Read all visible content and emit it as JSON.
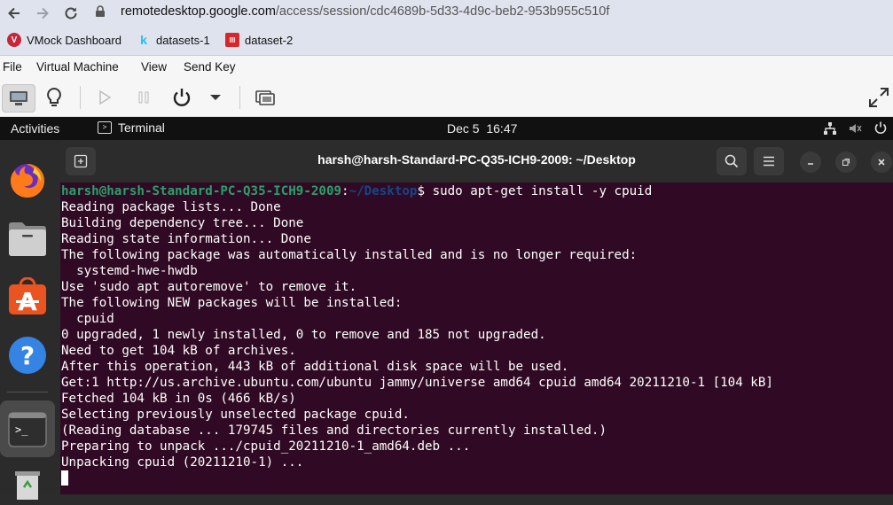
{
  "browser": {
    "url_host": "remotedesktop.google.com",
    "url_path": "/access/session/cdc4689b-5d33-4d9c-beb2-953b955c510f",
    "icons": [
      "back-arrow-icon",
      "forward-arrow-icon",
      "reload-icon",
      "site-info-icon"
    ]
  },
  "bookmarks": [
    {
      "label": "VMock Dashboard",
      "icon": "vmock-icon"
    },
    {
      "label": "datasets-1",
      "icon": "kaggle-icon"
    },
    {
      "label": "dataset-2",
      "icon": "iiith-icon"
    }
  ],
  "vm_menu": [
    "File",
    "Virtual Machine",
    "View",
    "Send Key"
  ],
  "vm_toolbar": {
    "icons": [
      "display-console-icon",
      "bulb-icon",
      "play-icon",
      "pause-icon",
      "power-icon",
      "dropdown-arrow-icon",
      "screenshot-icon",
      "fullscreen-icon"
    ]
  },
  "gnome": {
    "activities": "Activities",
    "app_name": "Terminal",
    "clock": "Dec 5  16:47",
    "status_icons": [
      "network-icon",
      "volume-muted-icon",
      "power-icon"
    ]
  },
  "dock": [
    "firefox-icon",
    "files-icon",
    "app-store-icon",
    "help-icon",
    "terminal-icon",
    "trash-icon"
  ],
  "terminal": {
    "title": "harsh@harsh-Standard-PC-Q35-ICH9-2009: ~/Desktop",
    "prompt_user": "harsh@harsh-Standard-PC-Q35-ICH9-2009",
    "prompt_sep": ":",
    "prompt_path": "~/Desktop",
    "prompt_dollar": "$ ",
    "command": "sudo apt-get install -y cpuid",
    "output": [
      "Reading package lists... Done",
      "Building dependency tree... Done",
      "Reading state information... Done",
      "The following package was automatically installed and is no longer required:",
      "  systemd-hwe-hwdb",
      "Use 'sudo apt autoremove' to remove it.",
      "The following NEW packages will be installed:",
      "  cpuid",
      "0 upgraded, 1 newly installed, 0 to remove and 185 not upgraded.",
      "Need to get 104 kB of archives.",
      "After this operation, 443 kB of additional disk space will be used.",
      "Get:1 http://us.archive.ubuntu.com/ubuntu jammy/universe amd64 cpuid amd64 20211210-1 [104 kB]",
      "Fetched 104 kB in 0s (466 kB/s)",
      "Selecting previously unselected package cpuid.",
      "(Reading database ... 179745 files and directories currently installed.)",
      "Preparing to unpack .../cpuid_20211210-1_amd64.deb ...",
      "Unpacking cpuid (20211210-1) ..."
    ]
  },
  "colors": {
    "terminal_bg": "#300a24",
    "prompt_user": "#26a269",
    "prompt_path": "#12488b"
  }
}
